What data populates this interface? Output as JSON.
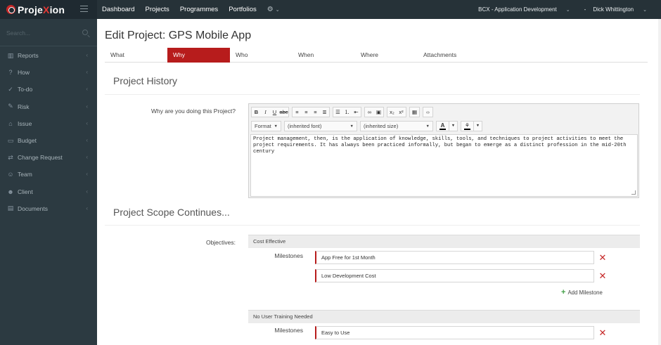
{
  "brand": {
    "name_prefix": "Proje",
    "name_x": "X",
    "name_suffix": "ion"
  },
  "topnav": {
    "items": [
      "Dashboard",
      "Projects",
      "Programmes",
      "Portfolios"
    ]
  },
  "topright": {
    "org": "BCX - Application Development",
    "separator": "-",
    "user": "Dick Whittington"
  },
  "sidebar": {
    "search_placeholder": "Search...",
    "items": [
      {
        "label": "Reports",
        "icon": "bar-chart-icon"
      },
      {
        "label": "How",
        "icon": "help-circle-icon"
      },
      {
        "label": "To-do",
        "icon": "check-circle-icon"
      },
      {
        "label": "Risk",
        "icon": "wrench-icon"
      },
      {
        "label": "Issue",
        "icon": "tag-icon"
      },
      {
        "label": "Budget",
        "icon": "wallet-icon"
      },
      {
        "label": "Change Request",
        "icon": "shuffle-icon"
      },
      {
        "label": "Team",
        "icon": "user-icon"
      },
      {
        "label": "Client",
        "icon": "client-icon"
      },
      {
        "label": "Documents",
        "icon": "folder-icon"
      }
    ]
  },
  "page": {
    "title": "Edit Project: GPS Mobile App",
    "tabs": [
      "What",
      "Why",
      "Who",
      "When",
      "Where",
      "Attachments"
    ],
    "active_tab": "Why"
  },
  "history": {
    "title": "Project History",
    "question_label": "Why are you doing this Project?",
    "editor": {
      "format_label": "Format",
      "font_label": "(inherited font)",
      "size_label": "(inherited size)",
      "text": "Project management, then, is the application of knowledge, skills, tools, and techniques to project activities to meet the project requirements. It has always been practiced informally, but began to emerge as a distinct profession in the mid-20th century"
    }
  },
  "scope": {
    "title": "Project Scope Continues...",
    "objectives_label": "Objectives:",
    "milestones_label": "Milestones",
    "add_milestone_label": "Add Milestone",
    "objectives": [
      {
        "name": "Cost Effective",
        "milestones": [
          "App Free for 1st Month",
          "Low Development Cost"
        ]
      },
      {
        "name": "No User Training  Needed",
        "milestones": [
          "Easy to Use"
        ]
      }
    ]
  },
  "colors": {
    "topbar": "#263238",
    "sidebar": "#2c3a41",
    "active_tab": "#b71c1c",
    "remove": "#c62828",
    "add": "#43a047"
  }
}
